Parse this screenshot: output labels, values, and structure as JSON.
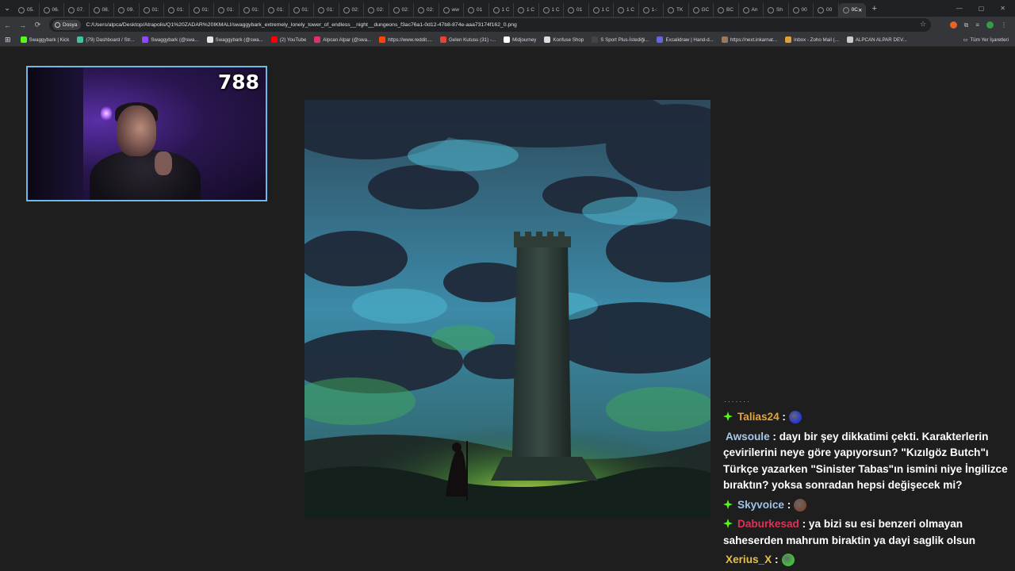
{
  "browser": {
    "tabs": [
      "05.",
      "06.",
      "07.",
      "08.",
      "09.",
      "01:",
      "01:",
      "01:",
      "01:",
      "01:",
      "01:",
      "01:",
      "01:",
      "02:",
      "02:",
      "02:",
      "02:",
      "ww",
      "01",
      "1 C",
      "1 C",
      "1 C",
      "01",
      "1 C",
      "1 C",
      "1-:",
      "TK",
      "GC",
      "BC",
      "An",
      "Sh",
      "00",
      "00",
      "0C"
    ],
    "new_tab": "+",
    "site_chip": "Dosya",
    "url": "C:/Users/alpca/Desktop/Atrapolis/Q1%20ZADAR%20IKMALI/swaggybark_extremely_lonely_tower_of_endless__night__dungeons_f3ac76a1-0d12-47b8-874e-aaa73174f162_0.png",
    "bookmarks": [
      {
        "label": "Swaggybark | Kick",
        "color": "#53fc18"
      },
      {
        "label": "(79) Dashboard / Str...",
        "color": "#3fc3a0"
      },
      {
        "label": "Swaggybark (@swa...",
        "color": "#9146ff"
      },
      {
        "label": "Swaggybark (@swa...",
        "color": "#e6e6e6"
      },
      {
        "label": "(2) YouTube",
        "color": "#ff0000"
      },
      {
        "label": "Alpcan Alpar (@swa...",
        "color": "#e1306c"
      },
      {
        "label": "https://www.reddit....",
        "color": "#ff4500"
      },
      {
        "label": "Gelen Kutusu (31) -...",
        "color": "#ea4335"
      },
      {
        "label": "Midjourney",
        "color": "#ffffff"
      },
      {
        "label": "Konfuse Shop",
        "color": "#dddddd"
      },
      {
        "label": "S Sport Plus-İstediği...",
        "color": "#444444"
      },
      {
        "label": "Excalidraw | Hand-d...",
        "color": "#6965db"
      },
      {
        "label": "https://next.inkarnat...",
        "color": "#9a7a5a"
      },
      {
        "label": "Inbox - Zoho Mail (...",
        "color": "#e0a030"
      },
      {
        "label": "ALPCAN ALPAR DEV...",
        "color": "#cccccc"
      }
    ],
    "all_bookmarks": "Tüm Yer İşaretleri"
  },
  "stream": {
    "counter": "788"
  },
  "chat": {
    "messages": [
      {
        "user": "Talias24",
        "user_color": "#e6a23c",
        "sep": " :",
        "text": "",
        "badge": true,
        "emote_color": "#2a3ad0"
      },
      {
        "user": "Awsoule",
        "user_color": "#a9c8e8",
        "sep": " : ",
        "text": "dayı bir şey dikkatimi çekti. Karakterlerin çevirilerini neye göre yapıyorsun? \"Kızılgöz Butch\"ı Türkçe yazarken \"Sinister Tabas\"ın ismini niye İngilizce bıraktın? yoksa sonradan hepsi değişecek mi?",
        "badge": false
      },
      {
        "user": "Skyvoice",
        "user_color": "#9fc2e8",
        "sep": " :",
        "text": "",
        "badge": true,
        "emote_color": "#7a4a3a"
      },
      {
        "user": "Daburkesad",
        "user_color": "#e0305a",
        "sep": " : ",
        "text": "ya bizi su esi benzeri olmayan saheserden mahrum biraktin ya dayi saglik olsun",
        "badge": true
      },
      {
        "user": "Xerius_X",
        "user_color": "#e6c04a",
        "sep": " :",
        "text": "",
        "badge": false,
        "emote_color": "#3fbf3f"
      }
    ]
  },
  "colors": {
    "accent_badge": "#53fc18",
    "webcam_border": "#6fb8e8"
  }
}
